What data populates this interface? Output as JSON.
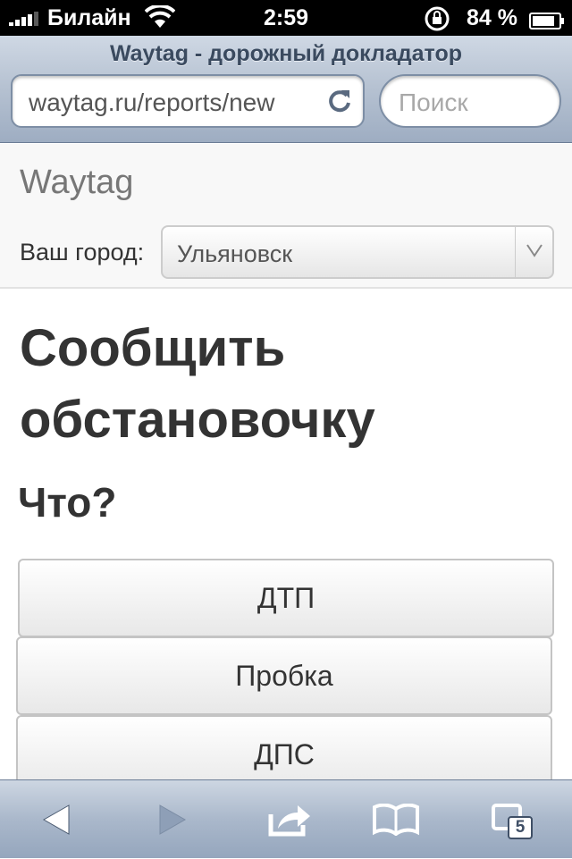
{
  "status_bar": {
    "carrier": "Билайн",
    "time": "2:59",
    "battery": "84 %"
  },
  "safari": {
    "page_title": "Waytag - дорожный докладатор",
    "url": "waytag.ru/reports/new",
    "search_placeholder": "Поиск",
    "open_tabs": "5"
  },
  "site": {
    "brand": "Waytag",
    "city_label": "Ваш город:",
    "city_value": "Ульяновск"
  },
  "main": {
    "headline": "Сообщить обстановочку",
    "question": "Что?",
    "options": [
      "ДТП",
      "Пробка",
      "ДПС"
    ]
  },
  "colors": {
    "toolbar_icon": "#ffffff",
    "safari_bar": "#b5c1d1",
    "text_dark": "#333333"
  }
}
